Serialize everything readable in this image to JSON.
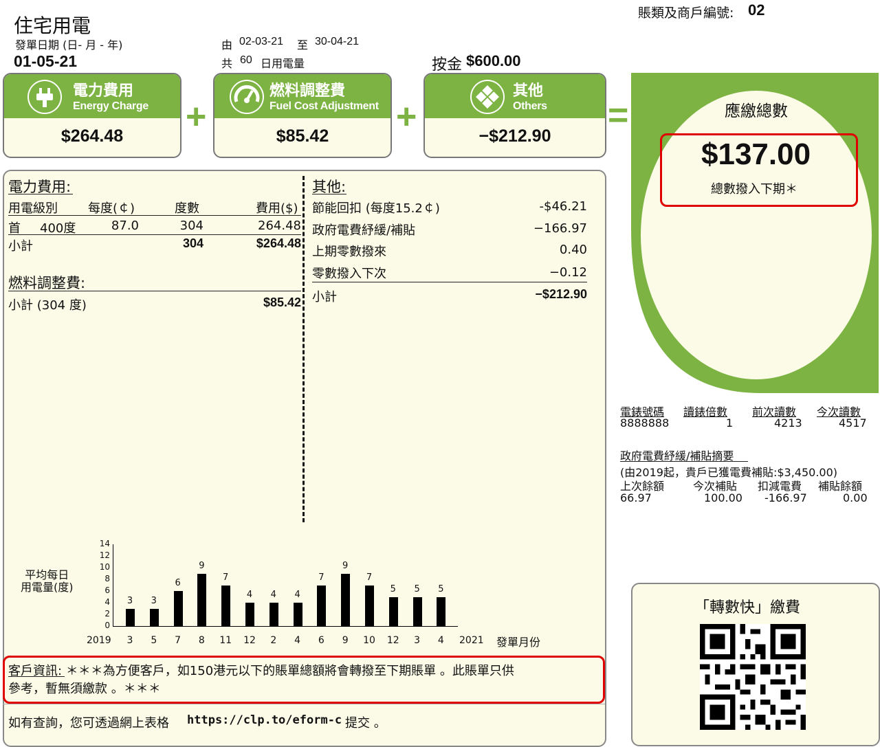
{
  "header": {
    "title": "住宅用電",
    "bill_date_label": "發單日期 (日- 月 - 年)",
    "bill_date": "01-05-21",
    "period_from_label": "由",
    "period_from": "02-03-21",
    "period_to_label": "至",
    "period_to": "30-04-21",
    "days_label_a": "共",
    "days": "60",
    "days_label_b": "日用電量",
    "deposit_label": "按金",
    "deposit": "$600.00",
    "account_label": "賬類及商戶編號:",
    "account_no": "02"
  },
  "summary": {
    "energy": {
      "zh": "電力費用",
      "en": "Energy Charge",
      "amount": "$264.48",
      "icon": "plug-icon"
    },
    "plus1": "+",
    "fuel": {
      "zh": "燃料調整費",
      "en": "Fuel Cost Adjustment",
      "amount": "$85.42",
      "icon": "gauge-icon"
    },
    "plus2": "+",
    "others": {
      "zh": "其他",
      "en": "Others",
      "amount": "−$212.90",
      "icon": "others-icon"
    },
    "equals": "=",
    "total_label": "應繳總數",
    "total": "$137.00",
    "total_note": "總數撥入下期＊"
  },
  "energy_detail": {
    "title": "電力費用:",
    "headers": [
      "用電級別",
      "每度(￠)",
      "度數",
      "費用($)"
    ],
    "row": {
      "tier_a": "首",
      "tier_b": "400度",
      "rate": "87.0",
      "units": "304",
      "cost": "264.48"
    },
    "subtotal_label": "小計",
    "subtotal_units": "304",
    "subtotal_cost": "$264.48"
  },
  "fuel_detail": {
    "title": "燃料調整費:",
    "subtotal_label": "小計 (304  度)",
    "subtotal_cost": "$85.42"
  },
  "others_detail": {
    "title": "其他:",
    "rows": [
      {
        "label": "節能回扣 (每度15.2￠)",
        "value": "-$46.21"
      },
      {
        "label": "政府電費紓緩/補貼",
        "value": "−166.97"
      },
      {
        "label": "上期零數撥來",
        "value": "0.40"
      },
      {
        "label": "零數撥入下次",
        "value": "−0.12"
      }
    ],
    "subtotal_label": "小計",
    "subtotal": "−$212.90"
  },
  "chart_data": {
    "type": "bar",
    "ylabel": "平均每日\n用電量(度)",
    "xlabel": "發單月份",
    "year_start": "2019",
    "year_end": "2021",
    "categories": [
      "3",
      "5",
      "7",
      "8",
      "11",
      "12",
      "2",
      "4",
      "6",
      "9",
      "10",
      "12",
      "3",
      "4"
    ],
    "values": [
      3,
      3,
      6,
      9,
      7,
      4,
      4,
      4,
      7,
      9,
      7,
      5,
      5,
      5
    ],
    "ylim": [
      0,
      14
    ],
    "yticks": [
      0,
      2,
      4,
      6,
      8,
      10,
      12,
      14
    ]
  },
  "customer_info": {
    "line1": "客戶資訊: ＊＊＊為方便客戶，如150港元以下的賬單總額將會轉撥至下期賬單 。此賬單只供",
    "line2": "參考，暫無須繳款 。＊＊＊"
  },
  "enquiry": {
    "text_a": "如有查詢，您可透過網上表格",
    "url": "https://clp.to/eform-c",
    "text_b": "提交 。"
  },
  "meter": {
    "headers": [
      "電錶號碼",
      "讀錶倍數",
      "前次讀數",
      "今次讀數"
    ],
    "values": [
      "8888888",
      "1",
      "4213",
      "4517"
    ]
  },
  "subsidy": {
    "title": "政府電費紓緩/補貼摘要",
    "note": "(由2019起，貴戶已獲電費補貼:$3,450.00)",
    "headers": [
      "上次餘額",
      "今次補貼",
      "扣減電費",
      "補貼餘額"
    ],
    "values": [
      "66.97",
      "100.00",
      "-166.97",
      "0.00"
    ]
  },
  "payment": {
    "title": "「轉數快」繳費",
    "qr": "qr-code"
  },
  "colors": {
    "green": "#7cb342",
    "cream": "#fbfbe8",
    "red": "#e00000"
  }
}
